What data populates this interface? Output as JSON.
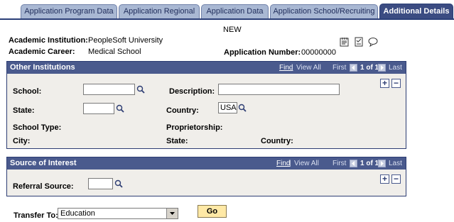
{
  "tabs": [
    {
      "label": "Application Program Data",
      "active": false
    },
    {
      "label": "Application Regional",
      "active": false
    },
    {
      "label": "Application Data",
      "active": false
    },
    {
      "label": "Application School/Recruiting",
      "active": false
    },
    {
      "label": "Additional Details",
      "active": true
    }
  ],
  "header": {
    "status": "NEW",
    "institution_label": "Academic Institution:",
    "institution_value": "PeopleSoft University",
    "career_label": "Academic Career:",
    "career_value": "Medical School",
    "app_number_label": "Application Number:",
    "app_number_value": "00000000",
    "icons": [
      "notepad-icon",
      "checklist-icon",
      "comment-icon"
    ]
  },
  "other_institutions": {
    "title": "Other Institutions",
    "find": "Find",
    "view_all": "View All",
    "first": "First",
    "count": "1 of 1",
    "last": "Last",
    "school_label": "School:",
    "school_value": "",
    "description_label": "Description:",
    "description_value": "",
    "state_label": "State:",
    "state_value": "",
    "country_label": "Country:",
    "country_value": "USA",
    "school_type_label": "School Type:",
    "proprietorship_label": "Proprietorship:",
    "city_label": "City:",
    "state2_label": "State:",
    "country2_label": "Country:"
  },
  "source_of_interest": {
    "title": "Source of Interest",
    "find": "Find",
    "view_all": "View All",
    "first": "First",
    "count": "1 of 1",
    "last": "Last",
    "referral_label": "Referral Source:",
    "referral_value": ""
  },
  "footer": {
    "transfer_label": "Transfer To:",
    "transfer_value": "Education",
    "go_label": "Go"
  },
  "colors": {
    "tab_active": "#3b4c82",
    "tab_inactive": "#a9b8d3",
    "grid_header": "#4a5a8d",
    "grid_body": "#f0eeea",
    "go_button": "#ffe9a6"
  }
}
